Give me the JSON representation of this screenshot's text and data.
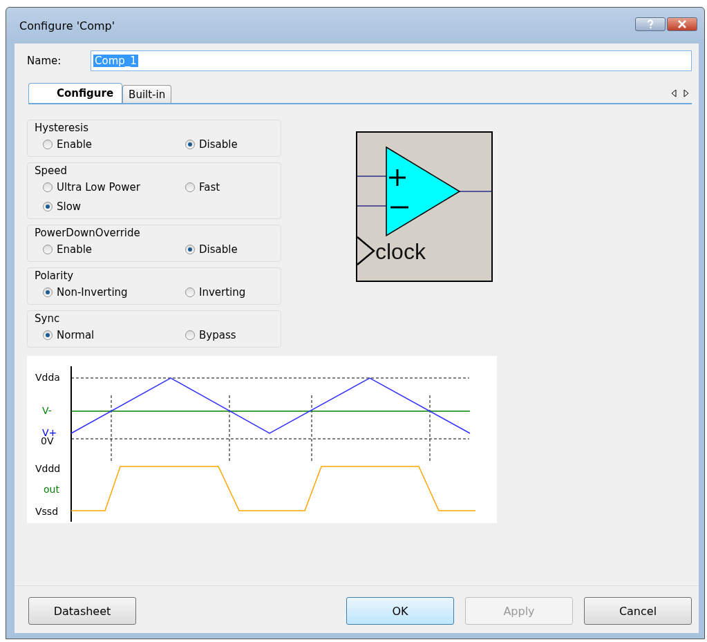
{
  "window": {
    "title": "Configure 'Comp'"
  },
  "name_field": {
    "label": "Name:",
    "value": "Comp_1"
  },
  "tabs": [
    {
      "label": "Configure",
      "selected": true
    },
    {
      "label": "Built-in",
      "selected": false
    }
  ],
  "groups": [
    {
      "title": "Hysteresis",
      "options": [
        {
          "label": "Enable",
          "selected": false
        },
        {
          "label": "Disable",
          "selected": true
        }
      ]
    },
    {
      "title": "Speed",
      "options": [
        {
          "label": "Ultra Low Power",
          "selected": false
        },
        {
          "label": "Fast",
          "selected": false
        },
        {
          "label": "Slow",
          "selected": true
        }
      ]
    },
    {
      "title": "PowerDownOverride",
      "options": [
        {
          "label": "Enable",
          "selected": false
        },
        {
          "label": "Disable",
          "selected": true
        }
      ]
    },
    {
      "title": "Polarity",
      "options": [
        {
          "label": "Non-Inverting",
          "selected": true
        },
        {
          "label": "Inverting",
          "selected": false
        }
      ]
    },
    {
      "title": "Sync",
      "options": [
        {
          "label": "Normal",
          "selected": true
        },
        {
          "label": "Bypass",
          "selected": false
        }
      ]
    }
  ],
  "symbol": {
    "clock_label": "clock"
  },
  "waveform": {
    "labels": [
      {
        "text": "Vdda",
        "color": "#000000"
      },
      {
        "text": "V-",
        "color": "#008000"
      },
      {
        "text": "V+",
        "color": "#0000ff"
      },
      {
        "text": "0V",
        "color": "#000000"
      },
      {
        "text": "Vddd",
        "color": "#000000"
      },
      {
        "text": "out",
        "color": "#008000"
      },
      {
        "text": "Vssd",
        "color": "#000000"
      }
    ]
  },
  "buttons": [
    {
      "label": "Datasheet",
      "disabled": false
    },
    {
      "label": "OK",
      "disabled": false
    },
    {
      "label": "Apply",
      "disabled": true
    },
    {
      "label": "Cancel",
      "disabled": false
    }
  ]
}
